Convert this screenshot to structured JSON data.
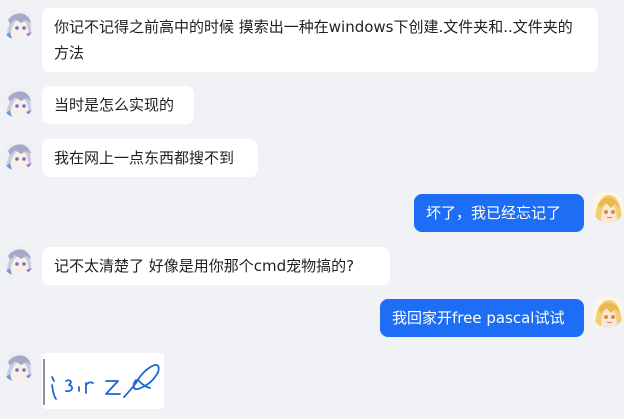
{
  "chat": {
    "messages": [
      {
        "sender": "friend",
        "text": "你记不记得之前高中的时候 摸索出一种在windows下创建.文件夹和..文件夹的方法"
      },
      {
        "sender": "friend",
        "text": "当时是怎么实现的"
      },
      {
        "sender": "friend",
        "text": "我在网上一点东西都搜不到"
      },
      {
        "sender": "me",
        "text": "坏了，我已经忘记了"
      },
      {
        "sender": "friend",
        "text": "记不太清楚了 好像是用你那个cmd宠物搞的?"
      },
      {
        "sender": "me",
        "text": "我回家开free pascal试试"
      },
      {
        "sender": "friend",
        "type": "sticker",
        "sticker": "handwritten-sketch"
      }
    ]
  },
  "colors": {
    "background": "#f0f2f5",
    "incoming_bubble": "#ffffff",
    "outgoing_bubble": "#1e6ef5",
    "incoming_text": "#1f1f1f",
    "outgoing_text": "#ffffff",
    "sketch_ink": "#1f66d1"
  }
}
